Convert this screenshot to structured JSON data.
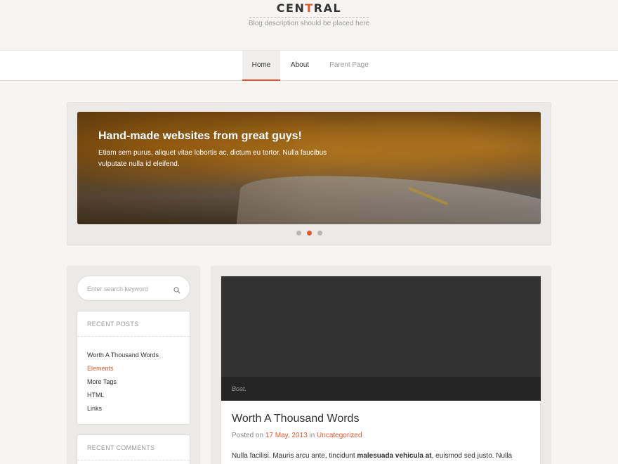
{
  "header": {
    "logo_before": "CEN",
    "logo_accent": "T",
    "logo_after": "RAL",
    "tagline": "Blog description should be placed here"
  },
  "nav": {
    "items": [
      {
        "label": "Home",
        "active": true
      },
      {
        "label": "About",
        "active": false
      },
      {
        "label": "Parent Page",
        "active": false
      }
    ]
  },
  "slider": {
    "title": "Hand-made websites from great guys!",
    "text": "Etiam sem purus, aliquet vitae lobortis ac, dictum eu tortor. Nulla faucibus vulputate nulla id eleifend.",
    "slide_count": 3,
    "active_slide": 2
  },
  "sidebar": {
    "search": {
      "placeholder": "Enter search keyword",
      "icon": "search-icon"
    },
    "recent_posts": {
      "title": "RECENT POSTS",
      "items": [
        "Worth A Thousand Words",
        "Elements",
        "More Tags",
        "HTML",
        "Links"
      ],
      "highlighted": "Elements"
    },
    "recent_comments": {
      "title": "RECENT COMMENTS"
    }
  },
  "post": {
    "image_caption": "Boat.",
    "title": "Worth A Thousand Words",
    "meta_posted_on": "Posted on",
    "meta_date": "17 May, 2013",
    "meta_in": "in",
    "meta_category": "Uncategorized",
    "excerpt_start": "Nulla facilisi. Mauris arcu ante, tincidunt ",
    "excerpt_bold": "malesuada vehicula at",
    "excerpt_end": ", euismod sed justo. Nulla"
  },
  "colors": {
    "accent": "#e6582b",
    "background": "#f6f5f3",
    "panel": "#ebeae8",
    "post_image": "#323232"
  }
}
